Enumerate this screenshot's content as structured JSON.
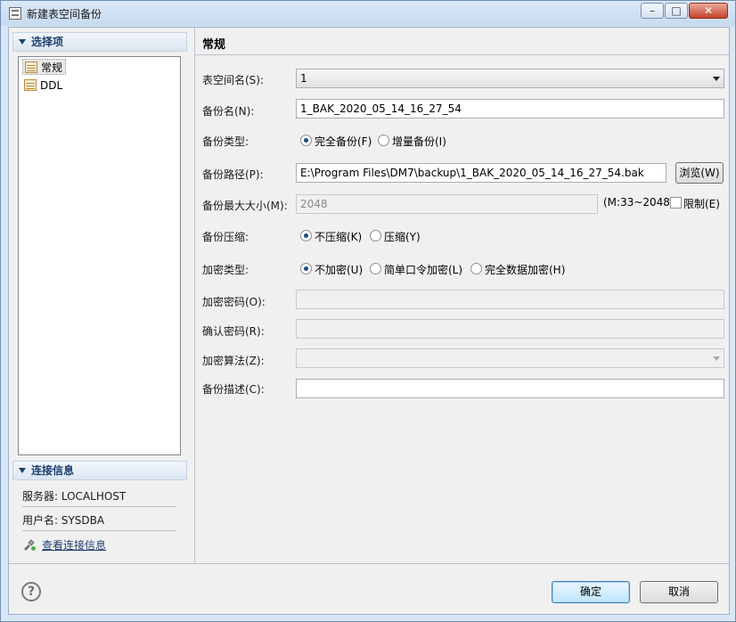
{
  "window": {
    "title": "新建表空间备份",
    "min": "–",
    "max": "□",
    "close": "✕"
  },
  "left": {
    "options_header": "选择项",
    "tree": [
      {
        "label": "常规",
        "selected": true
      },
      {
        "label": "DDL",
        "selected": false
      }
    ],
    "conn_header": "连接信息",
    "server": "服务器: LOCALHOST",
    "user": "用户名: SYSDBA",
    "view_link": "查看连接信息"
  },
  "main": {
    "title": "常规",
    "tablespace": {
      "label": "表空间名(S):",
      "value": "1"
    },
    "backup_name": {
      "label": "备份名(N):",
      "value": "1_BAK_2020_05_14_16_27_54"
    },
    "backup_type": {
      "label": "备份类型:",
      "options": [
        "完全备份(F)",
        "增量备份(I)"
      ],
      "selected": 0
    },
    "backup_path": {
      "label": "备份路径(P):",
      "value": "E:\\Program Files\\DM7\\backup\\1_BAK_2020_05_14_16_27_54.bak",
      "browse": "浏览(W)"
    },
    "max_size": {
      "label": "备份最大大小(M):",
      "value": "2048",
      "range": "(M:33~2048)",
      "limit_label": "限制(E)",
      "limit_checked": false
    },
    "compress": {
      "label": "备份压缩:",
      "options": [
        "不压缩(K)",
        "压缩(Y)"
      ],
      "selected": 0
    },
    "encrypt_type": {
      "label": "加密类型:",
      "options": [
        "不加密(U)",
        "简单口令加密(L)",
        "完全数据加密(H)"
      ],
      "selected": 0
    },
    "encrypt_pwd": {
      "label": "加密密码(O):",
      "value": ""
    },
    "confirm_pwd": {
      "label": "确认密码(R):",
      "value": ""
    },
    "encrypt_algo": {
      "label": "加密算法(Z):",
      "value": ""
    },
    "description": {
      "label": "备份描述(C):",
      "value": ""
    }
  },
  "footer": {
    "help": "?",
    "ok": "确定",
    "cancel": "取消"
  }
}
